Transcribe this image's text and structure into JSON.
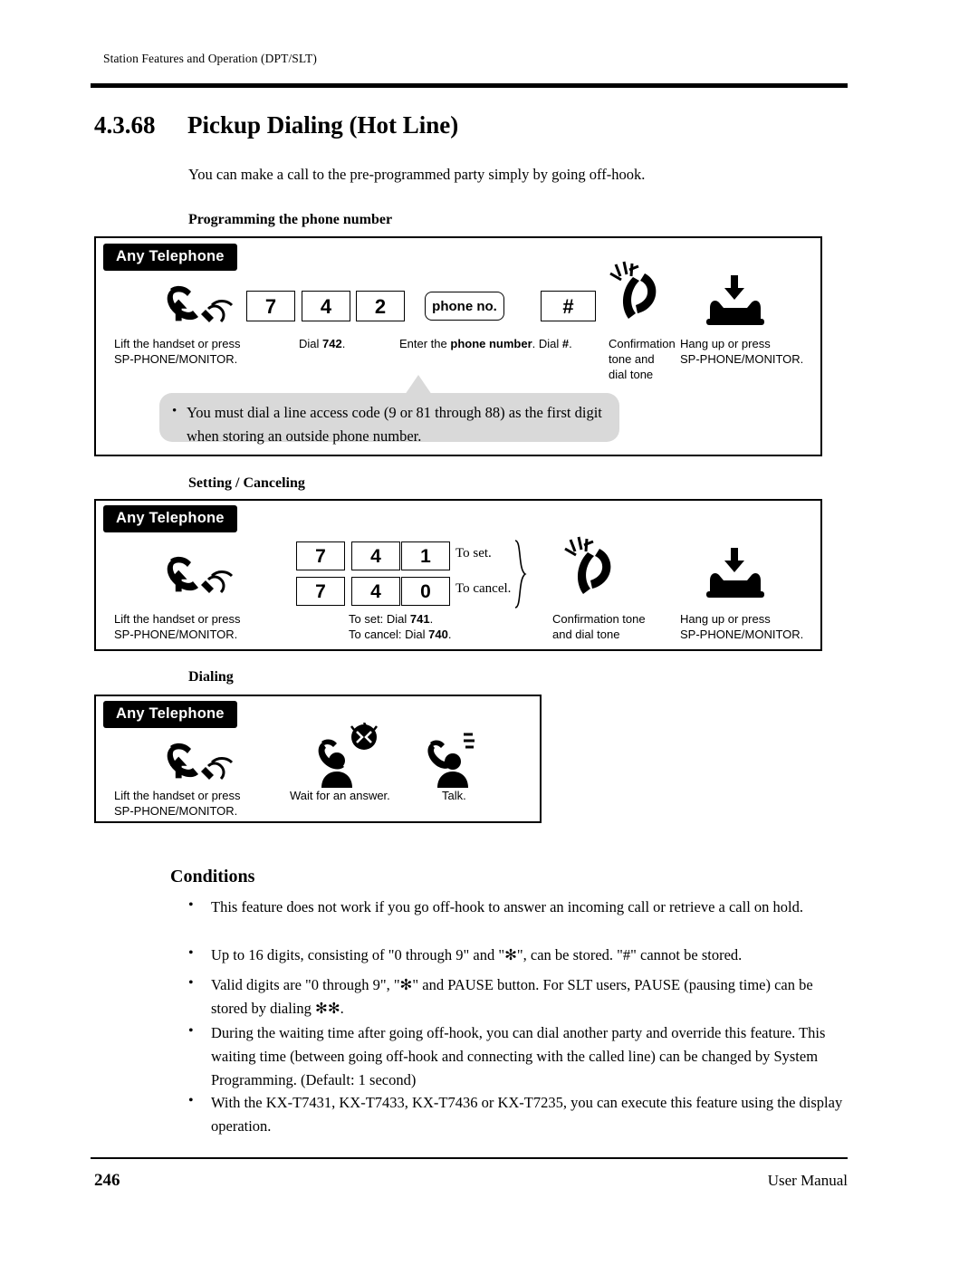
{
  "header": {
    "running_head": "Station Features and Operation (DPT/SLT)"
  },
  "title": {
    "number": "4.3.68",
    "text": "Pickup Dialing (Hot Line)"
  },
  "intro": "You can make a call to the pre-programmed party simply by going off-hook.",
  "sections": [
    {
      "heading": "Programming the phone number",
      "badge": "Any Telephone",
      "keys": [
        "7",
        "4",
        "2"
      ],
      "phone_no_label": "phone no.",
      "hash_key": "#",
      "captions": {
        "lift": "Lift the handset or press\nSP-PHONE/MONITOR.",
        "dial": "Dial 742.",
        "dial_bold": "742",
        "enter": "Enter the phone number. Dial #.",
        "enter_bold1": "phone number",
        "enter_bold2": "#",
        "confirm": "Confirmation\ntone and\ndial tone",
        "hangup": "Hang up or press\nSP-PHONE/MONITOR."
      },
      "note": "You must dial a line access code (9 or 81 through 88) as the first digit when storing an outside phone number."
    },
    {
      "heading": "Setting / Canceling",
      "badge": "Any Telephone",
      "row1_keys": [
        "7",
        "4",
        "1"
      ],
      "row2_keys": [
        "7",
        "4",
        "0"
      ],
      "row1_label": "To set.",
      "row2_label": "To cancel.",
      "captions": {
        "lift": "Lift the handset or press\nSP-PHONE/MONITOR.",
        "dial": "To set: Dial 741.\nTo cancel: Dial 740.",
        "dial_bold1": "741",
        "dial_bold2": "740",
        "confirm": "Confirmation tone\nand dial tone",
        "hangup": "Hang up or press\nSP-PHONE/MONITOR."
      }
    },
    {
      "heading": "Dialing",
      "badge": "Any Telephone",
      "captions": {
        "lift": "Lift the handset or press\nSP-PHONE/MONITOR.",
        "wait": "Wait for an answer.",
        "talk": "Talk."
      }
    }
  ],
  "conditions": {
    "heading": "Conditions",
    "items": [
      "This feature does not work if you go off-hook to answer an incoming call or retrieve a call on hold.",
      "Up to 16 digits, consisting of \"0 through 9\" and \"✻\", can be stored. \"#\" cannot be stored.",
      "Valid digits are \"0 through 9\", \"✻\" and PAUSE button. For SLT users, PAUSE (pausing time) can be stored by dialing ✻✻.",
      "During the waiting time after going off-hook, you can dial another party and override this feature. This waiting time (between going off-hook and connecting with the called line) can be changed by System Programming. (Default: 1 second)",
      "With the KX-T7431, KX-T7433, KX-T7436 or KX-T7235, you can execute this feature using the display operation."
    ]
  },
  "footer": {
    "page_number": "246",
    "doc_name": "User Manual"
  }
}
